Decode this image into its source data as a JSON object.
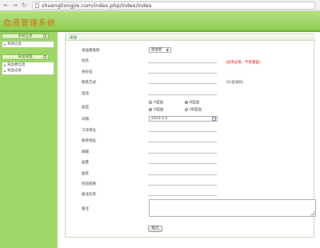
{
  "browser": {
    "back_icon": "back-arrow-icon",
    "forward_icon": "forward-arrow-icon",
    "reload_icon": "reload-icon",
    "url": "shuengliongjie.com/index.php/index/index"
  },
  "app": {
    "title": "血液管理系统",
    "accent": "#d56a14",
    "header_color": "#8fcf4f"
  },
  "sidebar": {
    "sections": [
      {
        "title": "系统信息",
        "toggle": "−",
        "items": [
          "系统信息"
        ]
      },
      {
        "title": "采血管理",
        "toggle": "−",
        "items": [
          "采血者信息",
          "采血记录"
        ]
      }
    ]
  },
  "form": {
    "tab_label": "采血",
    "type_select": {
      "label": "采血者类别",
      "value": "献血者"
    },
    "fields": [
      {
        "label": "姓名"
      },
      {
        "label": "身份证"
      },
      {
        "label": "联系方式"
      },
      {
        "label": "电话"
      }
    ],
    "red_hint": "（此项必填，不得重复）",
    "format_hint": "（11位号码）",
    "blood_type": {
      "label": "血型",
      "options": [
        {
          "label": "A型血",
          "checked": false
        },
        {
          "label": "B型血",
          "checked": true
        },
        {
          "label": "O型血",
          "checked": true
        },
        {
          "label": "AB型血",
          "checked": false
        }
      ]
    },
    "date_field": {
      "label": "日期",
      "value": "2013-1-1"
    },
    "more_fields": [
      {
        "label": "工作单位"
      },
      {
        "label": "联系地址"
      },
      {
        "label": "邮箱"
      },
      {
        "label": "血量"
      },
      {
        "label": "血浆"
      },
      {
        "label": "检验结果"
      },
      {
        "label": "备注信息"
      }
    ],
    "remark_label": "备注",
    "submit_label": "提交"
  }
}
